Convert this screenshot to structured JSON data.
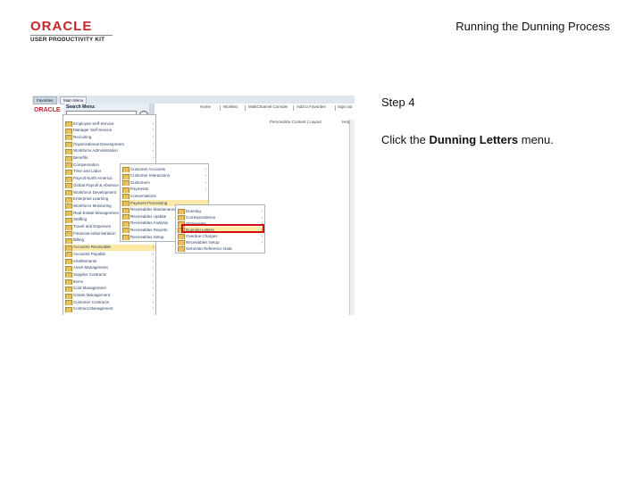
{
  "header": {
    "logo_brand": "ORACLE",
    "logo_product": "USER PRODUCTIVITY KIT",
    "document_title": "Running the Dunning Process"
  },
  "step": {
    "title": "Step 4",
    "instruction_prefix": "Click the ",
    "instruction_target": "Dunning Letters",
    "instruction_suffix": " menu."
  },
  "screenshot": {
    "tabs": [
      "Favorites",
      "Main Menu"
    ],
    "logo": "ORACLE",
    "top_links": [
      "Home",
      "Worklist",
      "MultiChannel Console",
      "Add to Favorites",
      "Sign out"
    ],
    "search_label": "Search Menu:",
    "page_link": "Personalize Content | Layout",
    "help_hint": "Help",
    "menu_level1": [
      "Employee Self-Service",
      "Manager Self-Service",
      "Recruiting",
      "Organizational Development",
      "Workforce Administration",
      "Benefits",
      "Compensation",
      "Time and Labor",
      "Payroll North America",
      "Global Payroll & Absence Mgmt",
      "Workforce Development",
      "Enterprise Learning",
      "Workforce Monitoring",
      "Real Estate Management",
      "Staffing",
      "Travel and Expenses",
      "Financial Administration",
      "Billing",
      "Accounts Receivable",
      "Accounts Payable",
      "eSettlements",
      "Asset Management",
      "Supplier Contracts",
      "Items",
      "Cost Management",
      "Grants Management",
      "Customer Contracts",
      "Contract Management"
    ],
    "menu_level2": [
      "Customer Accounts",
      "Customer Interactions",
      "Customers",
      "Payments",
      "Conversations",
      "Payment Processing",
      "Receivables Maintenance",
      "Receivables Update",
      "Receivables Analysis",
      "Receivables Reports",
      "Receivables Setup"
    ],
    "menu_level3": [
      "Dunning",
      "Correspondence",
      "Statements",
      "Dunning Letters",
      "Overdue Charges",
      "Receivables Setup",
      "Generate Reference Data"
    ]
  }
}
